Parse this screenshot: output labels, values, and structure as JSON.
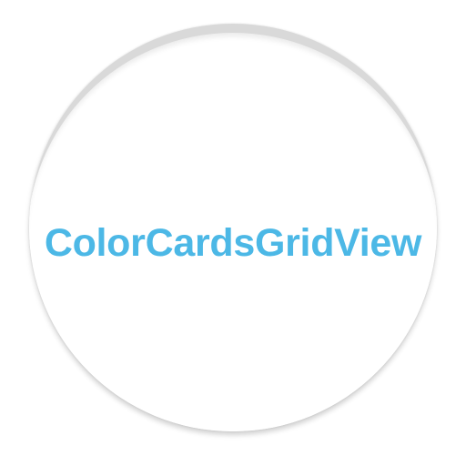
{
  "app_icon": {
    "label": "ColorCardsGridView",
    "text_color": "#4cb8e6",
    "background_color": "#ffffff"
  }
}
